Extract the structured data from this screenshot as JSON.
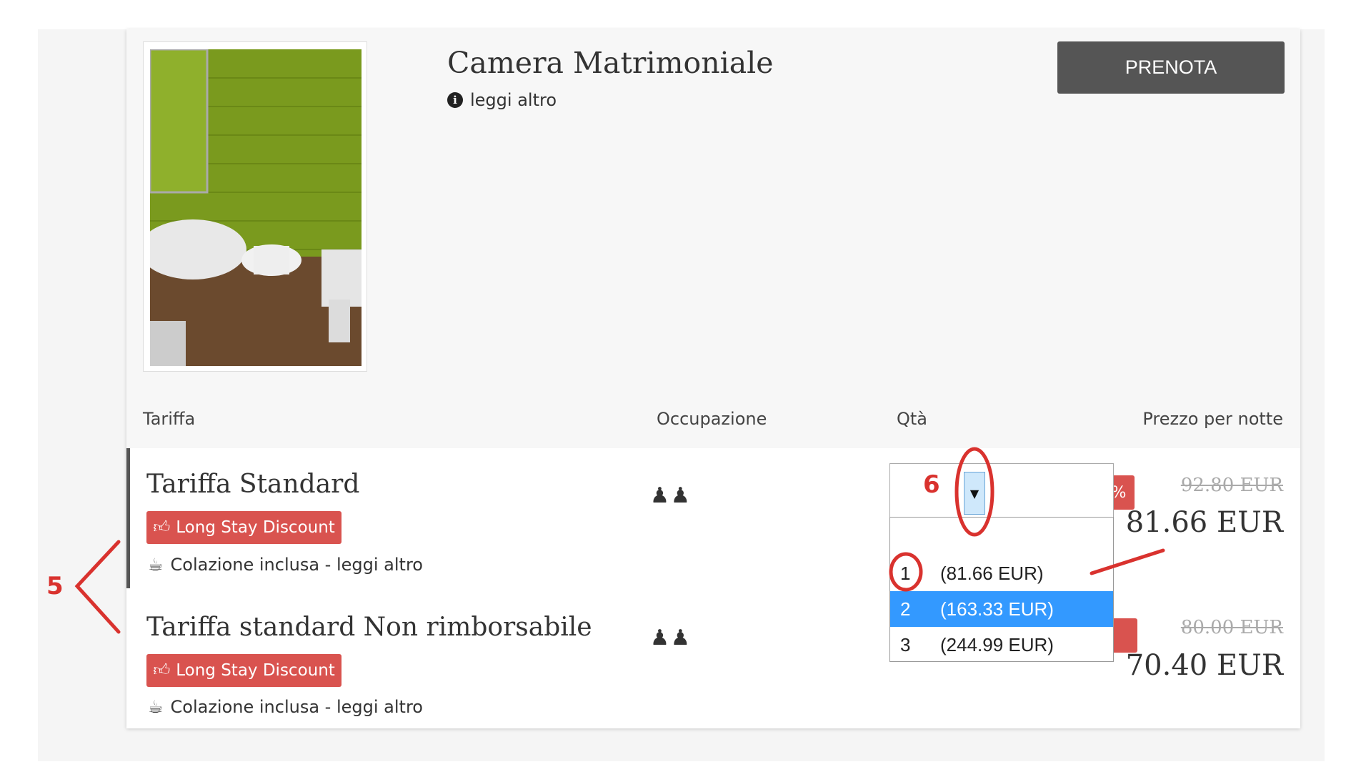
{
  "room": {
    "title": "Camera Matrimoniale",
    "read_more": "leggi altro",
    "book_label": "PRENOTA",
    "image_alt": "bathroom-photo"
  },
  "table": {
    "headers": [
      "Tariffa",
      "Occupazione",
      "Qtà",
      "Prezzo per notte"
    ]
  },
  "rates": [
    {
      "name": "Tariffa Standard",
      "badge": "Long Stay Discount",
      "includes": "Colazione inclusa - leggi altro",
      "occupancy_icon": "two-persons-icon",
      "discount": "-12%",
      "old_price": "92.80 EUR",
      "new_price": "81.66 EUR"
    },
    {
      "name": "Tariffa standard Non rimborsabile",
      "badge": "Long Stay Discount",
      "includes": "Colazione inclusa - leggi altro",
      "occupancy_icon": "two-persons-icon",
      "old_price": "80.00 EUR",
      "new_price": "70.40 EUR"
    }
  ],
  "qty_dropdown": {
    "options": [
      {
        "qty": "1",
        "price": "(81.66 EUR)"
      },
      {
        "qty": "2",
        "price": "(163.33 EUR)",
        "selected": true
      },
      {
        "qty": "3",
        "price": "(244.99 EUR)"
      }
    ]
  },
  "annotations": {
    "step_5": "5",
    "step_6": "6"
  },
  "colors": {
    "accent_red": "#d9534f",
    "button_dark": "#555555",
    "select_highlight": "#3399ff",
    "annotation_red": "#d9322e"
  }
}
